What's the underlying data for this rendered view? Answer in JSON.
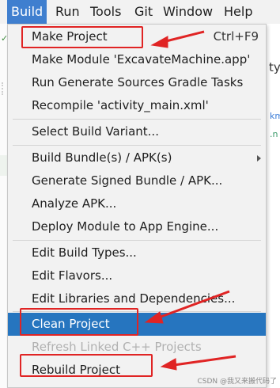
{
  "menubar": {
    "items": [
      {
        "label": "Build",
        "active": true
      },
      {
        "label": "Run"
      },
      {
        "label": "Tools"
      },
      {
        "label": "Git"
      },
      {
        "label": "Window"
      },
      {
        "label": "Help"
      }
    ]
  },
  "background": {
    "left_marker": "✓",
    "left_letters": "Ir",
    "right_text": "ty",
    "right_link_a": "km",
    "right_link_b": ".n"
  },
  "build_menu": {
    "make_project": {
      "label": "Make Project",
      "shortcut": "Ctrl+F9"
    },
    "make_module": {
      "label": "Make Module 'ExcavateMachine.app'"
    },
    "run_generate": {
      "label": "Run Generate Sources Gradle Tasks"
    },
    "recompile": {
      "label": "Recompile 'activity_main.xml'"
    },
    "select_variant": {
      "label": "Select Build Variant..."
    },
    "build_bundle": {
      "label": "Build Bundle(s) / APK(s)",
      "has_submenu": true
    },
    "generate_signed": {
      "label": "Generate Signed Bundle / APK..."
    },
    "analyze_apk": {
      "label": "Analyze APK..."
    },
    "deploy_module": {
      "label": "Deploy Module to App Engine..."
    },
    "edit_build_types": {
      "label": "Edit Build Types..."
    },
    "edit_flavors": {
      "label": "Edit Flavors..."
    },
    "edit_libraries": {
      "label": "Edit Libraries and Dependencies..."
    },
    "clean_project": {
      "label": "Clean Project",
      "selected": true
    },
    "refresh_linked": {
      "label": "Refresh Linked C++ Projects",
      "disabled": true
    },
    "rebuild_project": {
      "label": "Rebuild Project"
    }
  },
  "colors": {
    "menu_active": "#3f7fcf",
    "item_selected": "#2675bf",
    "annotation_red": "#e02424",
    "disabled_text": "#b1b1b1"
  },
  "watermark": "CSDN @我又来搬代码了"
}
